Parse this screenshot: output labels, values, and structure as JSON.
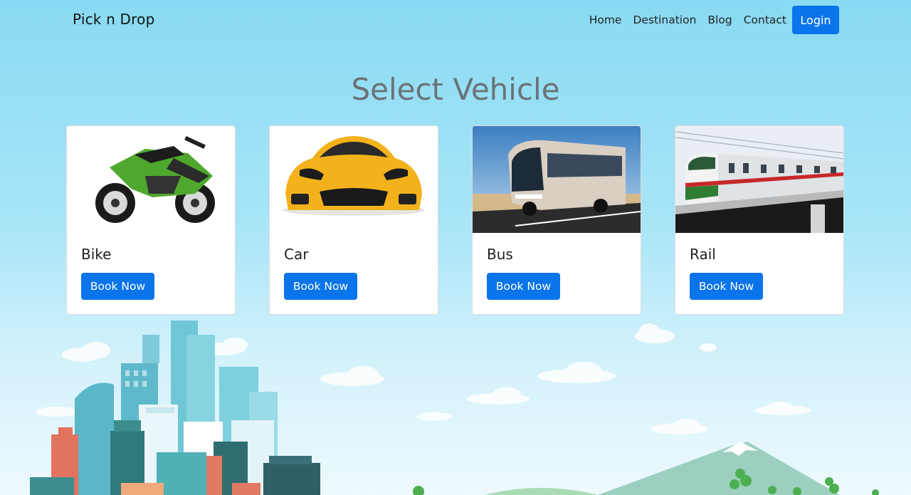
{
  "navbar": {
    "brand": "Pick n Drop",
    "links": [
      "Home",
      "Destination",
      "Blog",
      "Contact"
    ],
    "login_label": "Login"
  },
  "main": {
    "title": "Select Vehicle",
    "vehicles": [
      {
        "name": "Bike",
        "button": "Book Now",
        "image": "motorbike-image"
      },
      {
        "name": "Car",
        "button": "Book Now",
        "image": "sports-car-image"
      },
      {
        "name": "Bus",
        "button": "Book Now",
        "image": "bus-image"
      },
      {
        "name": "Rail",
        "button": "Book Now",
        "image": "train-image"
      }
    ]
  },
  "colors": {
    "primary_button": "#0a74ea",
    "background_top": "#89daf3",
    "title_text": "#6b7276"
  }
}
